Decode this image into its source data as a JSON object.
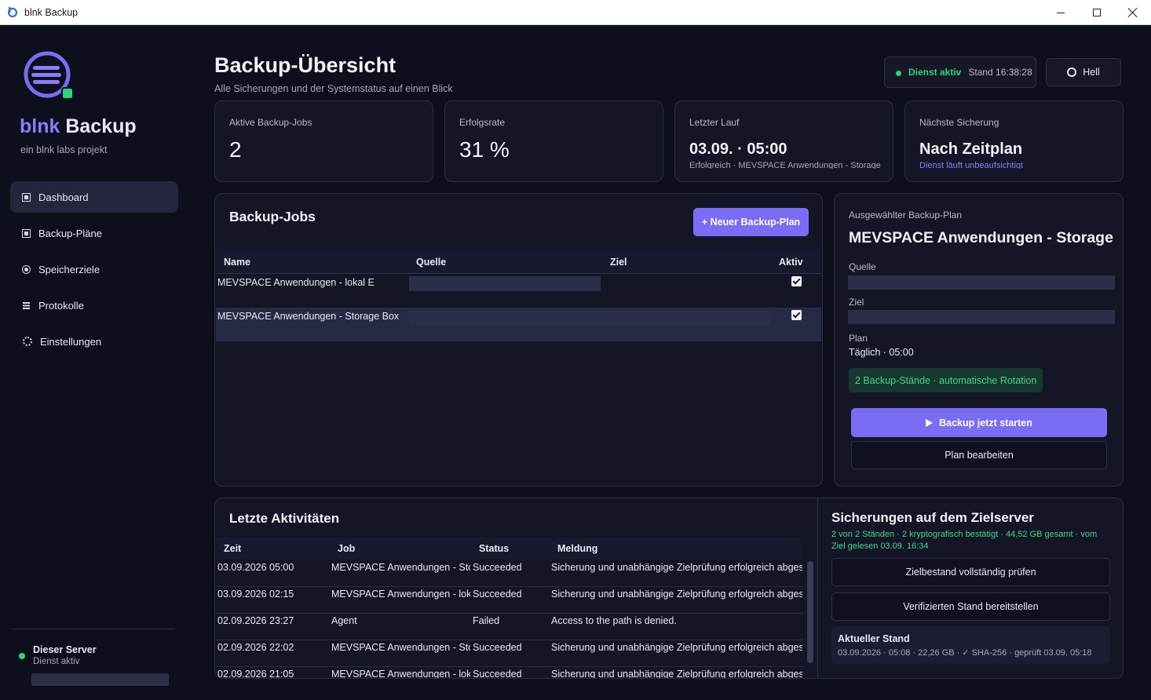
{
  "window": {
    "title": "blnk Backup"
  },
  "sidebar": {
    "brand_primary": "blnk",
    "brand_secondary": " Backup",
    "tagline": "ein blnk labs projekt",
    "items": [
      {
        "label": "Dashboard",
        "icon": "grid-icon",
        "active": true
      },
      {
        "label": "Backup-Pläne",
        "icon": "plan-icon",
        "active": false
      },
      {
        "label": "Speicherziele",
        "icon": "target-icon",
        "active": false
      },
      {
        "label": "Protokolle",
        "icon": "log-icon",
        "active": false
      },
      {
        "label": "Einstellungen",
        "icon": "gear-icon",
        "active": false
      }
    ],
    "server": {
      "title": "Dieser Server",
      "status": "Dienst aktiv"
    }
  },
  "header": {
    "title": "Backup-Übersicht",
    "subtitle": "Alle Sicherungen und der Systemstatus auf einen Blick",
    "service_status": "Dienst aktiv",
    "stand": "Stand 16:38:28",
    "theme_label": "Hell"
  },
  "stats": [
    {
      "label": "Aktive Backup-Jobs",
      "value": "2",
      "note": ""
    },
    {
      "label": "Erfolgsrate",
      "value": "31 %",
      "note": ""
    },
    {
      "label": "Letzter Lauf",
      "value": "03.09. · 05:00",
      "note": "Erfolgreich · MEVSPACE Anwendungen - Storage Box"
    },
    {
      "label": "Nächste Sicherung",
      "value": "Nach Zeitplan",
      "note": "Dienst läuft unbeaufsichtigt"
    }
  ],
  "jobs": {
    "title": "Backup-Jobs",
    "new_button": "+ Neuer Backup-Plan",
    "columns": [
      "Name",
      "Quelle",
      "Ziel",
      "Aktiv"
    ],
    "rows": [
      {
        "name": "MEVSPACE Anwendungen - lokal E",
        "active": true,
        "selected": false
      },
      {
        "name": "MEVSPACE Anwendungen - Storage Box",
        "active": true,
        "selected": true
      }
    ]
  },
  "detail": {
    "label": "Ausgewählter Backup-Plan",
    "title": "MEVSPACE Anwendungen - Storage",
    "source_label": "Quelle",
    "target_label": "Ziel",
    "plan_label": "Plan",
    "plan_value": "Täglich · 05:00",
    "rotation": "2 Backup-Stände · automatische Rotation",
    "start_button": "Backup jetzt starten",
    "edit_button": "Plan bearbeiten"
  },
  "activities": {
    "title": "Letzte Aktivitäten",
    "columns": [
      "Zeit",
      "Job",
      "Status",
      "Meldung"
    ],
    "rows": [
      {
        "time": "03.09.2026 05:00",
        "job": "MEVSPACE Anwendungen - Storage Box",
        "status": "Succeeded",
        "message": "Sicherung und unabhängige Zielprüfung erfolgreich abgeschlossen."
      },
      {
        "time": "03.09.2026 02:15",
        "job": "MEVSPACE Anwendungen - lokal E",
        "status": "Succeeded",
        "message": "Sicherung und unabhängige Zielprüfung erfolgreich abgeschlossen."
      },
      {
        "time": "02.09.2026 23:27",
        "job": "Agent",
        "status": "Failed",
        "message": "Access to the path is denied."
      },
      {
        "time": "02.09.2026 22:02",
        "job": "MEVSPACE Anwendungen - Storage Box",
        "status": "Succeeded",
        "message": "Sicherung und unabhängige Zielprüfung erfolgreich abgeschlossen."
      },
      {
        "time": "02.09.2026 21:05",
        "job": "MEVSPACE Anwendungen - lokal E",
        "status": "Succeeded",
        "message": "Sicherung und unabhängige Zielprüfung erfolgreich abgeschlossen."
      }
    ]
  },
  "zielserver": {
    "title": "Sicherungen auf dem Zielserver",
    "summary": "2 von 2 Ständen · 2 kryptografisch bestätigt · 44,52 GB gesamt · vom Ziel gelesen 03.09. 16:34",
    "check_button": "Zielbestand vollständig prüfen",
    "provide_button": "Verifizierten Stand bereitstellen",
    "current_title": "Aktueller Stand",
    "current_detail": "03.09.2026 · 05:08 · 22,26 GB · ✓ SHA-256 · geprüft 03.09. 05:18"
  },
  "colors": {
    "accent": "#7b6cf6",
    "success": "#2ed47a",
    "background": "#0d0f1c",
    "card": "#141626"
  }
}
